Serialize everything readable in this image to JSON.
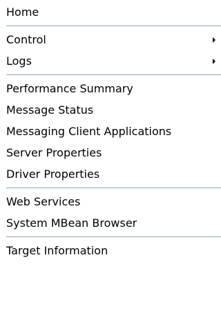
{
  "menu": {
    "home": "Home",
    "control": "Control",
    "logs": "Logs",
    "performance_summary": "Performance Summary",
    "message_status": "Message Status",
    "messaging_client_applications": "Messaging Client Applications",
    "server_properties": "Server Properties",
    "driver_properties": "Driver Properties",
    "web_services": "Web Services",
    "system_mbean_browser": "System MBean Browser",
    "target_information": "Target Information"
  },
  "colors": {
    "separator": "#8da3c0",
    "background": "#ffffff",
    "text": "#000000"
  }
}
